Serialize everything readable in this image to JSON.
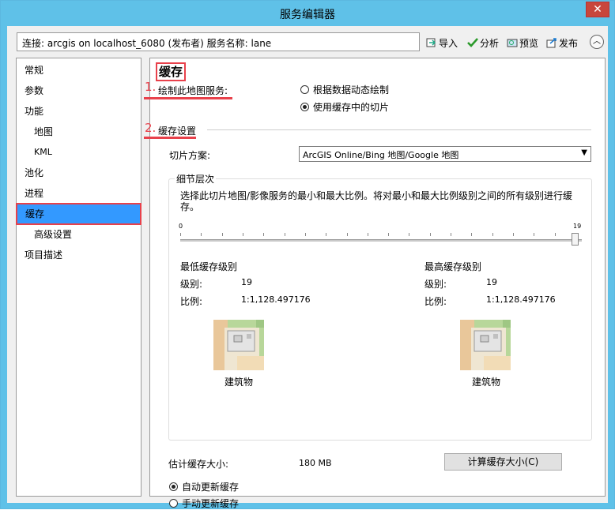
{
  "window": {
    "title": "服务编辑器",
    "close_glyph": "✕"
  },
  "connection": {
    "text": "连接: arcgis on localhost_6080 (发布者)   服务名称: lane"
  },
  "toolbar": {
    "import": "导入",
    "analyze": "分析",
    "preview": "预览",
    "publish": "发布",
    "collapse_glyph": "︿"
  },
  "nav": {
    "items": [
      "常规",
      "参数",
      "功能",
      "地图",
      "KML",
      "池化",
      "进程",
      "缓存",
      "高级设置",
      "项目描述"
    ]
  },
  "content": {
    "heading": "缓存",
    "marker1": "1.",
    "marker2": "2.",
    "draw_label": "绘制此地图服务:",
    "draw_opt1": "根据数据动态绘制",
    "draw_opt2": "使用缓存中的切片",
    "cache_settings": "缓存设置",
    "scheme_label": "切片方案:",
    "scheme_value": "ArcGIS Online/Bing 地图/Google 地图",
    "lod_legend": "细节层次",
    "lod_desc": "选择此切片地图/影像服务的最小和最大比例。将对最小和最大比例级别之间的所有级别进行缓存。",
    "slider_min": "0",
    "slider_max": "19",
    "min_title": "最低缓存级别",
    "max_title": "最高缓存级别",
    "level_label": "级别:",
    "scale_label": "比例:",
    "min_level": "19",
    "max_level": "19",
    "min_scale": "1:1,128.497176",
    "max_scale": "1:1,128.497176",
    "building_label": "建筑物",
    "est_label": "估计缓存大小:",
    "est_value": "180 MB",
    "calc_button": "计算缓存大小(C)",
    "auto_update": "自动更新缓存",
    "manual_update": "手动更新缓存"
  },
  "colors": {
    "accent": "#5fc1e8",
    "highlight": "#3399ff",
    "annotation": "#e8414b"
  }
}
